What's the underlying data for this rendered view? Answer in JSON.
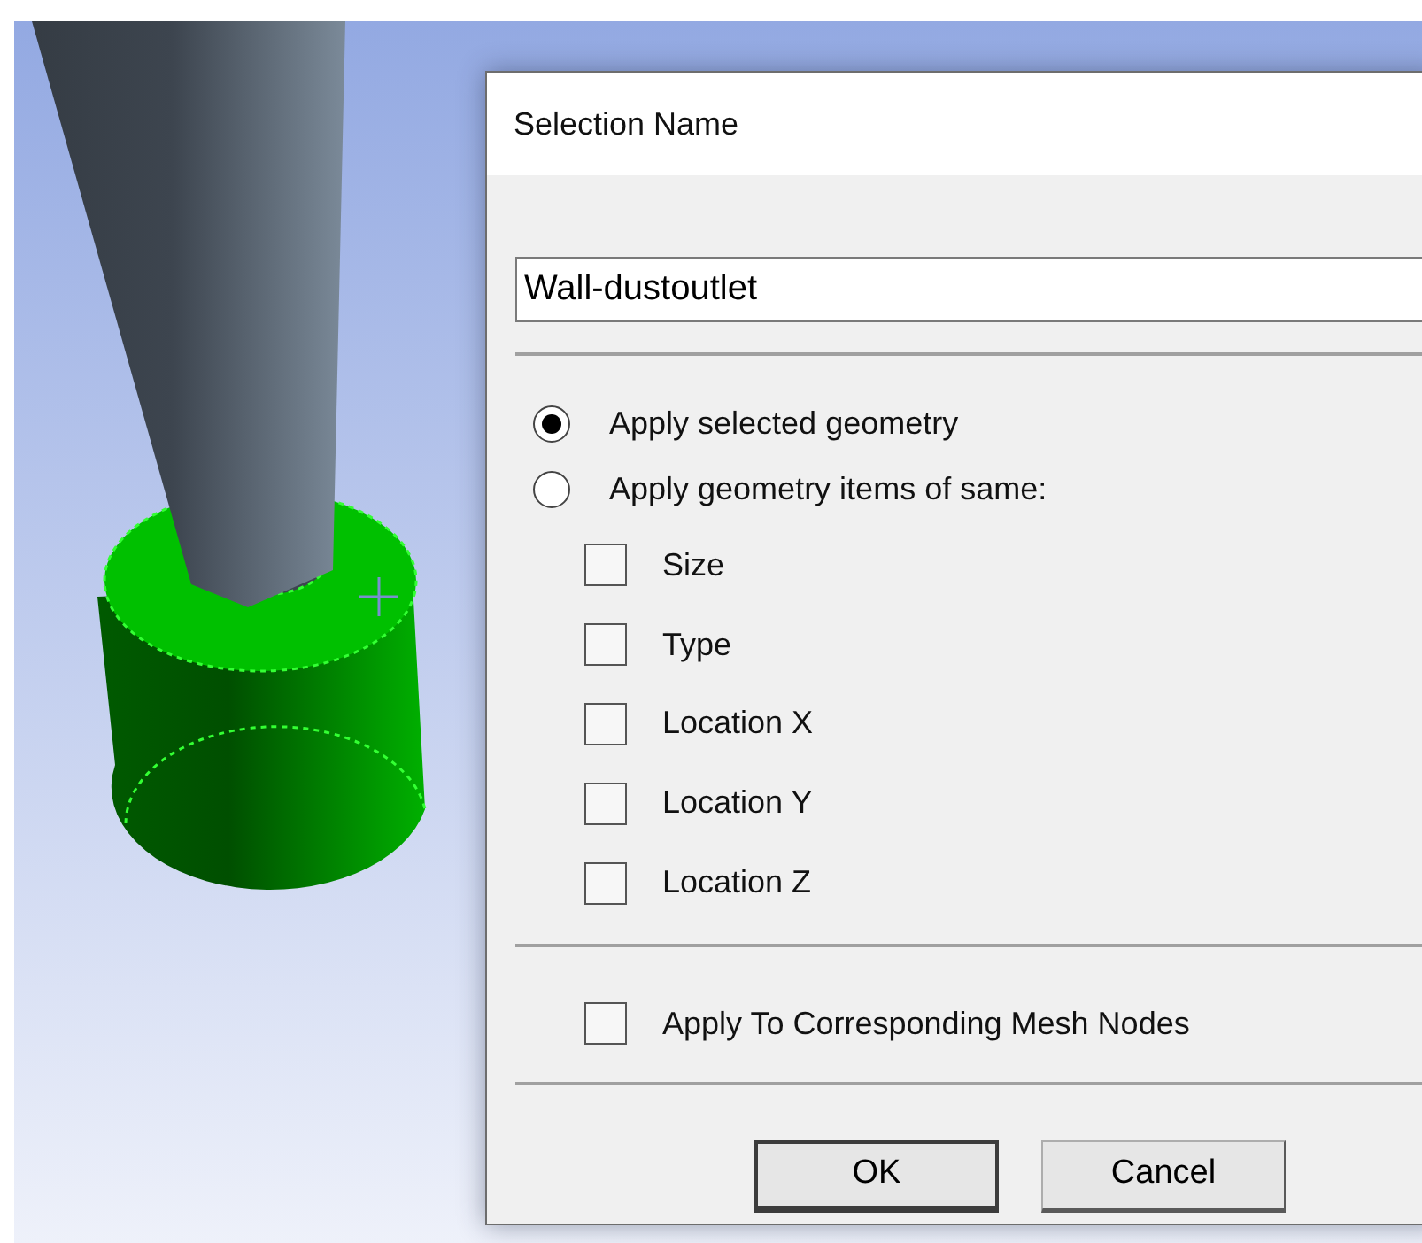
{
  "dialog": {
    "title": "Selection Name",
    "name_field": {
      "value": "Wall-dustoutlet"
    },
    "options": [
      {
        "label": "Apply selected geometry",
        "selected": true
      },
      {
        "label": "Apply geometry items of same:",
        "selected": false
      }
    ],
    "criteria": [
      {
        "label": "Size",
        "checked": false
      },
      {
        "label": "Type",
        "checked": false
      },
      {
        "label": "Location X",
        "checked": false
      },
      {
        "label": "Location Y",
        "checked": false
      },
      {
        "label": "Location Z",
        "checked": false
      }
    ],
    "mesh_nodes": {
      "label": "Apply To Corresponding Mesh Nodes",
      "checked": false
    },
    "buttons": [
      {
        "label": "OK",
        "kind": "default"
      },
      {
        "label": "Cancel",
        "kind": "normal"
      }
    ]
  }
}
